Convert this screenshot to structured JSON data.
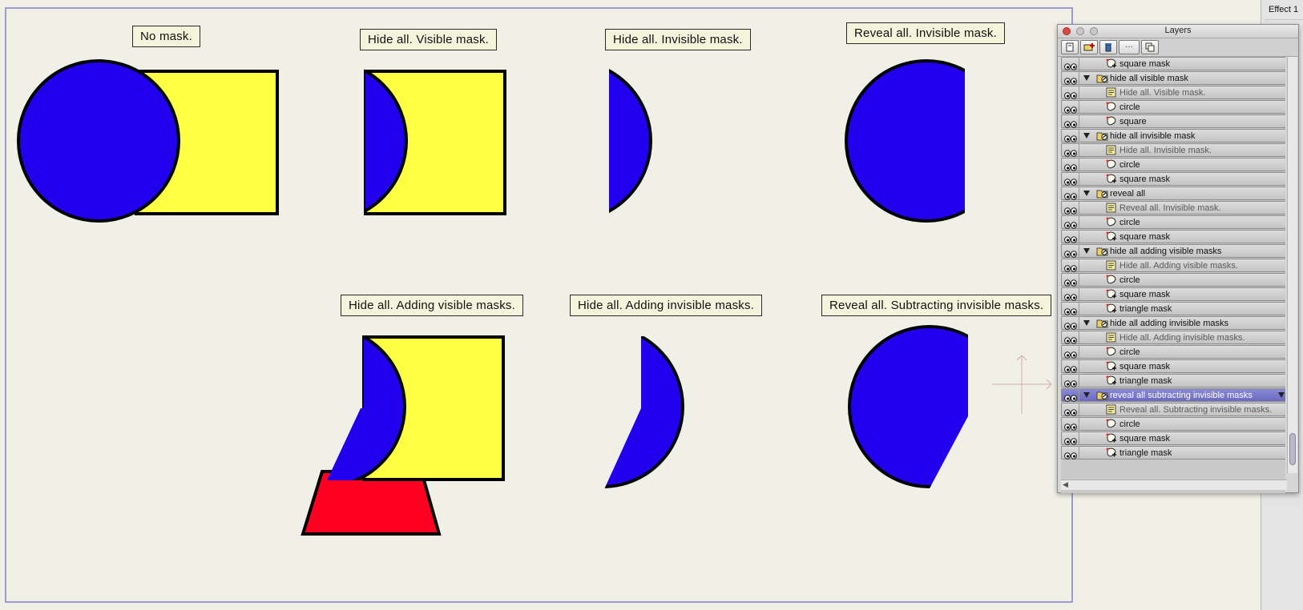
{
  "canvas": {
    "labels": [
      {
        "id": "no-mask",
        "text": "No mask."
      },
      {
        "id": "hide-all-visible",
        "text": "Hide all. Visible mask."
      },
      {
        "id": "hide-all-invisible",
        "text": "Hide all. Invisible mask."
      },
      {
        "id": "reveal-all-invisible",
        "text": "Reveal all. Invisible mask."
      },
      {
        "id": "hide-all-adding-visible",
        "text": "Hide all. Adding visible masks."
      },
      {
        "id": "hide-all-adding-invisible",
        "text": "Hide all. Adding invisible masks."
      },
      {
        "id": "reveal-all-subtracting",
        "text": "Reveal all. Subtracting invisible masks."
      }
    ],
    "colors": {
      "background": "#f0f0e6",
      "border": "#9c9cd0",
      "circle": "#2200ee",
      "square": "#ffff44",
      "triangle": "#ff0022",
      "stroke": "#000000",
      "crosshair": "#d8a8a8"
    }
  },
  "app": {
    "effect_label": "Effect 1"
  },
  "layers_panel": {
    "title": "Layers",
    "toolbar": [
      {
        "icon": "new-layer-icon"
      },
      {
        "icon": "new-folder-icon"
      },
      {
        "icon": "trash-icon"
      },
      {
        "icon": "more-icon",
        "label": "···"
      },
      {
        "icon": "duplicate-icon"
      }
    ],
    "rows": [
      {
        "name": "square mask",
        "kind": "mask",
        "depth": 1
      },
      {
        "name": "hide all visible mask",
        "kind": "group",
        "depth": 0
      },
      {
        "name": "Hide all. Visible mask.",
        "kind": "note",
        "depth": 1
      },
      {
        "name": "circle",
        "kind": "shape",
        "depth": 1
      },
      {
        "name": "square",
        "kind": "shape",
        "depth": 1
      },
      {
        "name": "hide all invisible mask",
        "kind": "group",
        "depth": 0
      },
      {
        "name": "Hide all. Invisible mask.",
        "kind": "note",
        "depth": 1
      },
      {
        "name": "circle",
        "kind": "shape",
        "depth": 1
      },
      {
        "name": "square mask",
        "kind": "mask",
        "depth": 1
      },
      {
        "name": "reveal all",
        "kind": "group",
        "depth": 0
      },
      {
        "name": "Reveal all. Invisible mask.",
        "kind": "note",
        "depth": 1
      },
      {
        "name": "circle",
        "kind": "shape",
        "depth": 1
      },
      {
        "name": "square mask",
        "kind": "mask",
        "depth": 1
      },
      {
        "name": "hide all adding visible masks",
        "kind": "group",
        "depth": 0
      },
      {
        "name": "Hide all. Adding visible masks.",
        "kind": "note",
        "depth": 1
      },
      {
        "name": "circle",
        "kind": "shape",
        "depth": 1
      },
      {
        "name": "square mask",
        "kind": "mask",
        "depth": 1
      },
      {
        "name": "triangle mask",
        "kind": "mask",
        "depth": 1
      },
      {
        "name": "hide all adding invisible masks",
        "kind": "group",
        "depth": 0
      },
      {
        "name": "Hide all. Adding invisible masks.",
        "kind": "note",
        "depth": 1
      },
      {
        "name": "circle",
        "kind": "shape",
        "depth": 1
      },
      {
        "name": "square mask",
        "kind": "mask",
        "depth": 1
      },
      {
        "name": "triangle mask",
        "kind": "mask",
        "depth": 1
      },
      {
        "name": "reveal all subtracting invisible masks",
        "kind": "group",
        "depth": 0,
        "selected": true
      },
      {
        "name": "Reveal all. Subtracting invisible masks.",
        "kind": "note",
        "depth": 1
      },
      {
        "name": "circle",
        "kind": "shape",
        "depth": 1
      },
      {
        "name": "square mask",
        "kind": "mask",
        "depth": 1
      },
      {
        "name": "triangle mask",
        "kind": "mask",
        "depth": 1
      }
    ]
  }
}
